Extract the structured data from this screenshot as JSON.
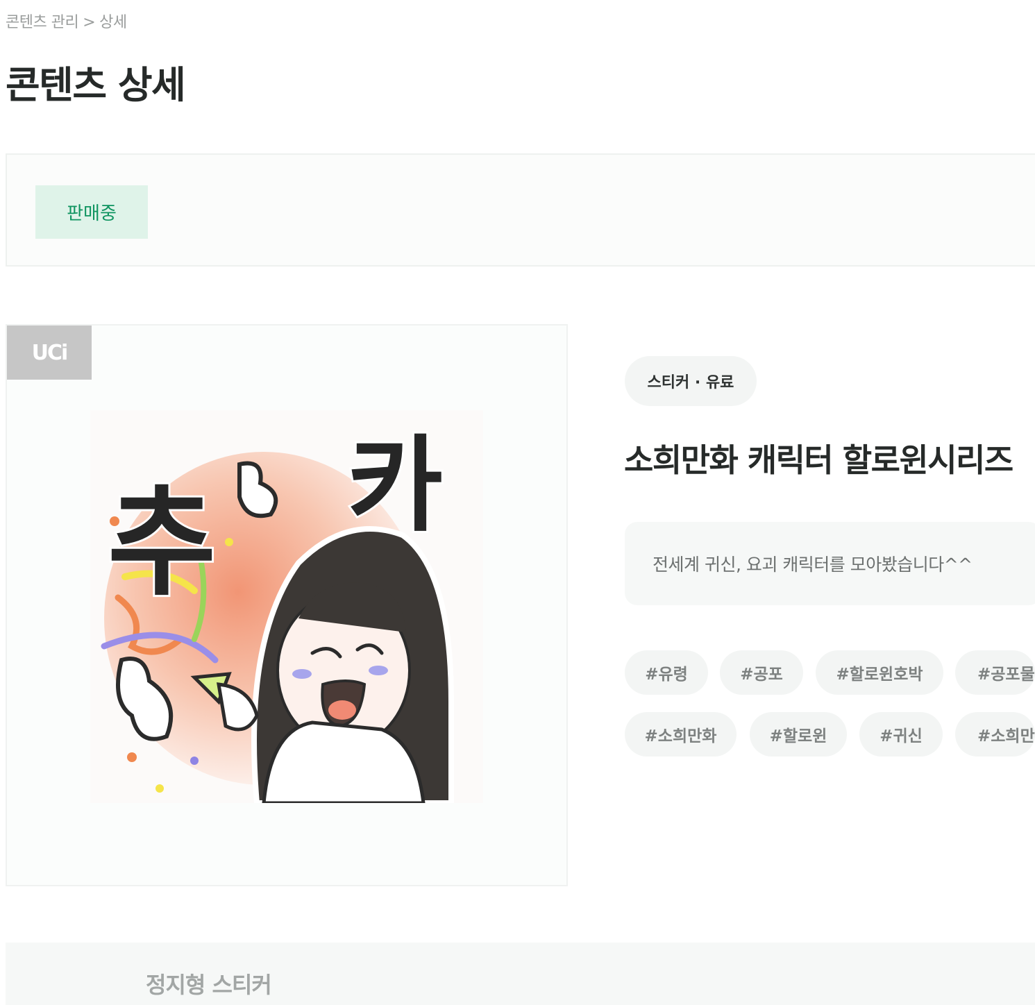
{
  "breadcrumb": {
    "parent": "콘텐츠 관리",
    "separator": ">",
    "current": "상세"
  },
  "page": {
    "title": "콘텐츠 상세"
  },
  "status": {
    "label": "판매중",
    "color": "#0f9460",
    "background": "#dff3e9"
  },
  "content": {
    "uci_badge": "UCi",
    "type_label": "스티커 · 유료",
    "title": "소희만화 캐릭터 할로윈시리즈",
    "description": "전세계 귀신, 요괴 캐릭터를 모아봤습니다^^",
    "sticker_text": [
      "추",
      "카"
    ],
    "tags": [
      "#유령",
      "#공포",
      "#할로윈호박",
      "#공포물",
      "#소희만화",
      "#할로윈",
      "#귀신",
      "#소희만화"
    ]
  },
  "section": {
    "title": "정지형 스티커"
  }
}
